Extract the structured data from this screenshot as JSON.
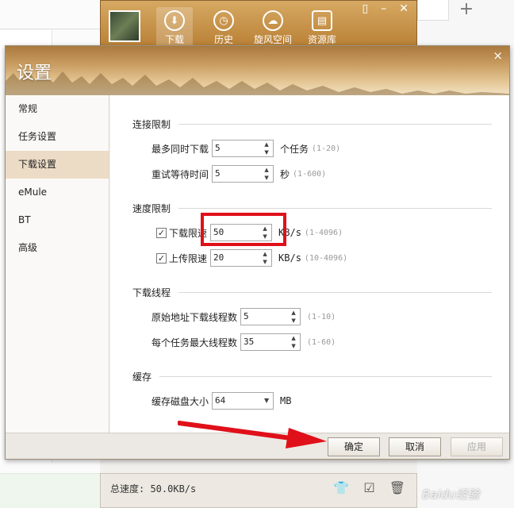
{
  "main_window": {
    "nav": [
      {
        "label": "下载",
        "icon": "download-icon"
      },
      {
        "label": "历史",
        "icon": "history-icon"
      },
      {
        "label": "旋风空间",
        "icon": "cloud-icon"
      },
      {
        "label": "资源库",
        "icon": "library-icon"
      }
    ],
    "status_speed": "总速度: 50.0KB/s"
  },
  "dialog": {
    "title": "设置",
    "close_glyph": "×",
    "sidebar": [
      {
        "label": "常规"
      },
      {
        "label": "任务设置"
      },
      {
        "label": "下载设置",
        "active": true
      },
      {
        "label": "eMule"
      },
      {
        "label": "BT"
      },
      {
        "label": "高级"
      }
    ],
    "connection": {
      "title": "连接限制",
      "max_tasks_label": "最多同时下载",
      "max_tasks_value": "5",
      "max_tasks_unit": "个任务",
      "max_tasks_range": "(1-20)",
      "retry_label": "重试等待时间",
      "retry_value": "5",
      "retry_unit": "秒",
      "retry_range": "(1-600)"
    },
    "speed": {
      "title": "速度限制",
      "download_label": "下载限速",
      "download_checked": true,
      "download_value": "50",
      "download_unit": "KB/s",
      "download_range": "(1-4096)",
      "upload_label": "上传限速",
      "upload_checked": true,
      "upload_value": "20",
      "upload_unit": "KB/s",
      "upload_range": "(10-4096)"
    },
    "threads": {
      "title": "下载线程",
      "origin_label": "原始地址下载线程数",
      "origin_value": "5",
      "origin_range": "(1-10)",
      "per_task_label": "每个任务最大线程数",
      "per_task_value": "35",
      "per_task_range": "(1-60)"
    },
    "cache": {
      "title": "缓存",
      "disk_label": "缓存磁盘大小",
      "disk_value": "64",
      "disk_unit": "MB"
    },
    "buttons": {
      "ok": "确定",
      "cancel": "取消",
      "apply": "应用"
    }
  },
  "watermark": "Baidu经验",
  "colors": {
    "highlight": "#e0101a",
    "header_brown": "#b98035"
  }
}
